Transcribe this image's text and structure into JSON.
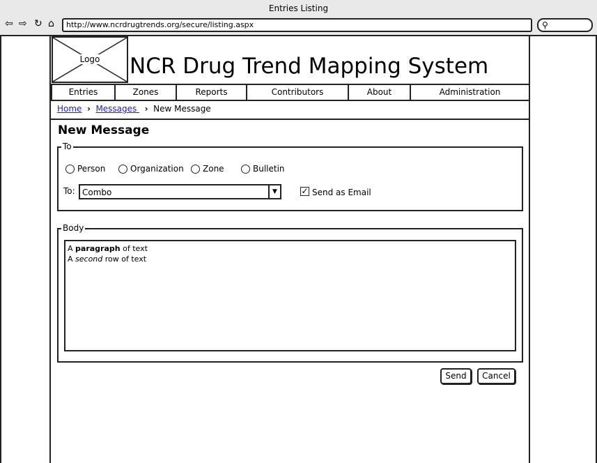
{
  "window": {
    "title": "Entries Listing",
    "url": "http://www.ncrdrugtrends.org/secure/listing.aspx",
    "nav_icons": [
      "back-icon",
      "forward-icon",
      "reload-icon",
      "home-icon"
    ],
    "search_icon": "search-icon"
  },
  "header": {
    "logo_label": "Logo",
    "site_title": "NCR Drug Trend Mapping System"
  },
  "nav": {
    "tabs": [
      {
        "label": "Entries"
      },
      {
        "label": "Zones"
      },
      {
        "label": "Reports"
      },
      {
        "label": "Contributors"
      },
      {
        "label": "About"
      },
      {
        "label": "Administration"
      }
    ]
  },
  "breadcrumb": {
    "items": [
      {
        "label": "Home"
      },
      {
        "label": "Messages "
      },
      {
        "label": "New Message"
      }
    ],
    "separator": "›"
  },
  "page": {
    "heading": "New Message"
  },
  "to_section": {
    "legend": "To",
    "radios": [
      {
        "label": "Person"
      },
      {
        "label": "Organization"
      },
      {
        "label": "Zone"
      },
      {
        "label": "Bulletin"
      }
    ],
    "to_label": "To:",
    "combo_value": "Combo",
    "send_email_label": "Send as Email",
    "send_email_checked": true
  },
  "body_section": {
    "legend": "Body",
    "line1": {
      "prefix": "A ",
      "bold": "paragraph",
      "suffix": " of text"
    },
    "line2": {
      "prefix": "A ",
      "italic": "second",
      "suffix": " row of text"
    }
  },
  "actions": {
    "send_label": "Send",
    "cancel_label": "Cancel"
  }
}
